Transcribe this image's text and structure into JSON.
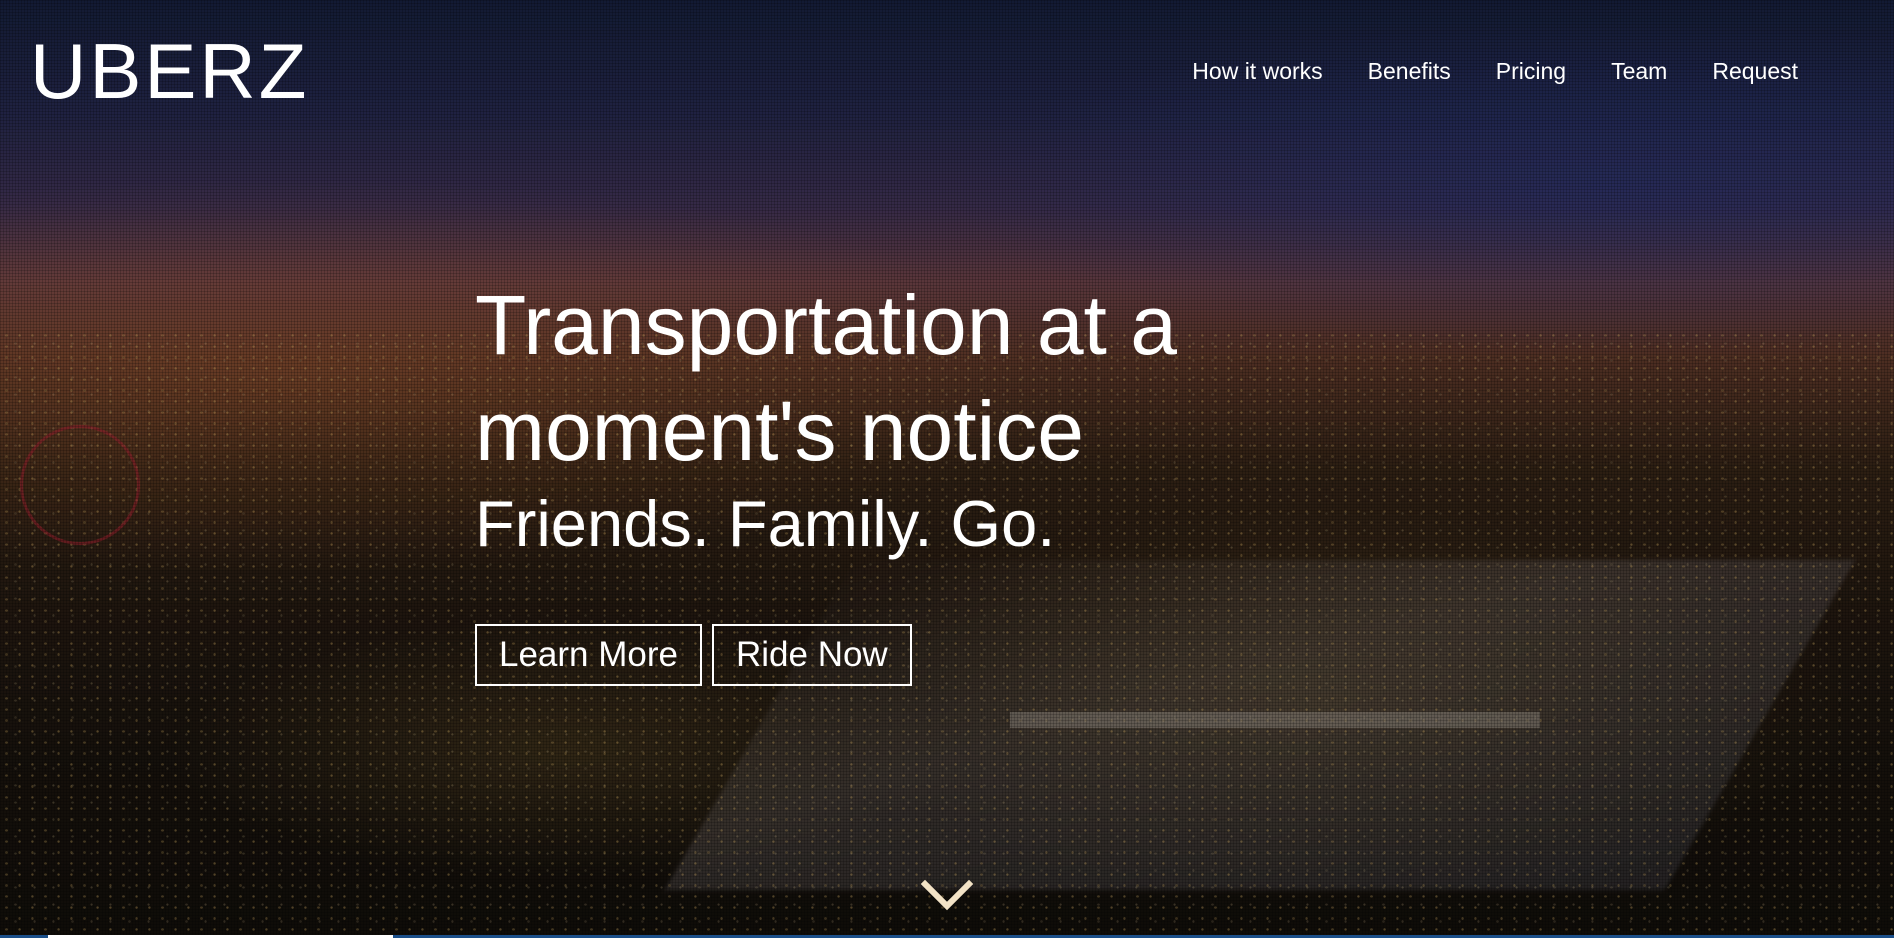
{
  "header": {
    "logo": "UBERZ",
    "nav": [
      "How it works",
      "Benefits",
      "Pricing",
      "Team",
      "Request"
    ]
  },
  "hero": {
    "headline_line1": "Transportation at a",
    "headline_line2": "moment's notice",
    "tagline": "Friends. Family. Go.",
    "buttons": {
      "learn_more": "Learn More",
      "ride_now": "Ride Now"
    },
    "scroll_icon": "chevron-down-icon"
  },
  "colors": {
    "text": "#ffffff",
    "bottom_bar": "#1b4f8a",
    "chevron": "#f3e3c6"
  }
}
